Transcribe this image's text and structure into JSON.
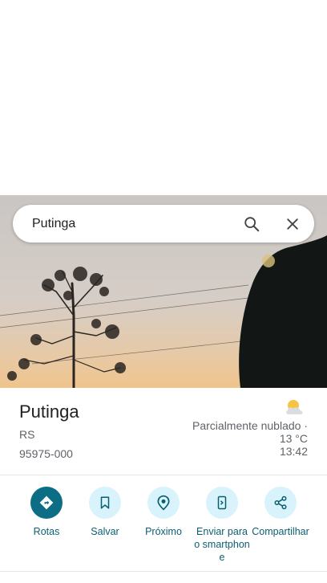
{
  "search": {
    "query": "Putinga"
  },
  "place": {
    "name": "Putinga",
    "region": "RS",
    "postal_code": "95975-000"
  },
  "weather": {
    "condition": "Parcialmente nublado ·",
    "temperature": "13 °C",
    "time": "13:42",
    "icon": "partly-cloudy-icon"
  },
  "actions": [
    {
      "label": "Rotas",
      "icon": "directions-icon"
    },
    {
      "label": "Salvar",
      "icon": "bookmark-icon"
    },
    {
      "label": "Próximo",
      "icon": "nearby-icon"
    },
    {
      "label": "Enviar para o smartphone",
      "icon": "send-to-phone-icon"
    },
    {
      "label": "Compartilhar",
      "icon": "share-icon"
    }
  ],
  "colors": {
    "primary": "#0b6e85",
    "action_bg": "#d8f3fb",
    "label": "#0b5e70"
  }
}
